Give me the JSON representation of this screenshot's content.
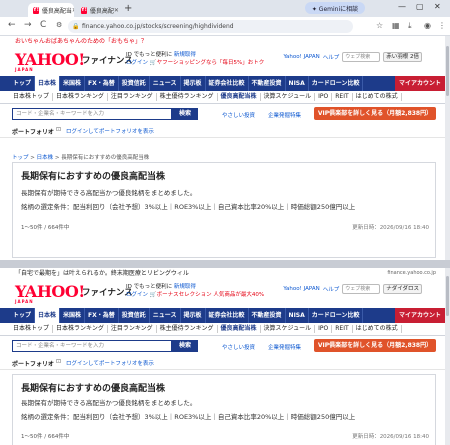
{
  "browser": {
    "tabs": [
      {
        "title": "優良高配当",
        "favicon": "Y!"
      },
      {
        "title": "優良高配",
        "favicon": "Y!"
      }
    ],
    "new_tab": "+",
    "gemini": "✦ Geminiに相談",
    "url": "finance.yahoo.co.jp/stocks/screening/highdividend",
    "back": "←",
    "forward": "→",
    "reload": "C",
    "win_min": "—",
    "win_max": "▢",
    "win_close": "✕"
  },
  "top": {
    "promo": "おいちゃんおばあちゃんのための「おもちゃ」？",
    "logo": "YAHOO!",
    "logo_sub": "JAPAN",
    "brand": "ファイナンス",
    "mast_line1": "ID でもっと便利に",
    "mast_link1": "新規取得",
    "mast_line2_login": "ログイン",
    "mast_line2_promo": "ヤフーショッピングなら「毎日5%」おトク",
    "mast_right_link1": "Yahoo! JAPAN",
    "mast_right_link2": "ヘルプ",
    "mast_search_placeholder": "ウェブ検索",
    "mast_btn": "赤い羽根 2倍"
  },
  "nav": {
    "items": [
      "トップ",
      "日本株",
      "米国株",
      "FX・為替",
      "投資信託",
      "ニュース",
      "掲示板",
      "証券会社比較",
      "不動産投資",
      "NISA",
      "カードローン比較"
    ],
    "account": "マイアカウント"
  },
  "subnav": {
    "items": [
      "日本株トップ",
      "日本株ランキング",
      "注目ランキング",
      "株主優待ランキング",
      "優良高配当株",
      "決算スケジュール",
      "IPO",
      "REIT",
      "はじめての株式"
    ]
  },
  "search": {
    "placeholder": "コード・企業名・キーワードを入力",
    "button": "検索",
    "link1": "やさしい投資",
    "link2": "企業発掘特集",
    "vip": "VIP俱楽部を詳しく見る（月額2,838円）"
  },
  "portfolio": {
    "label": "ポートフォリオ",
    "login": "ログインしてポートフォリオを表示"
  },
  "breadcrumb": {
    "top": "トップ",
    "jp": "日本株",
    "current": "長期保有におすすめの優良高配当株"
  },
  "card": {
    "title": "長期保有におすすめの優良高配当株",
    "desc": "長期保有が期待できる高配当かつ優良銘柄をまとめました。",
    "criteria": "銘柄の選定条件：配当利回り（会社予想）3%以上｜ROE3%以上｜自己資本比率20%以上｜時価総額250億円以上",
    "count": "1〜50件 / 664件中",
    "updated": "更新日時：2026/09/16 18:40"
  },
  "bottom": {
    "promo": "「自宅で最期を」は叶えられるか。終末期医療とリビングウィル",
    "ad_label": "finance.yahoo.co.jp",
    "mast_btn": "ナダイダロス",
    "mast_line2_promo": "ボーナスセレクション",
    "mast_line2_extra": "人気商品が最大40%"
  }
}
